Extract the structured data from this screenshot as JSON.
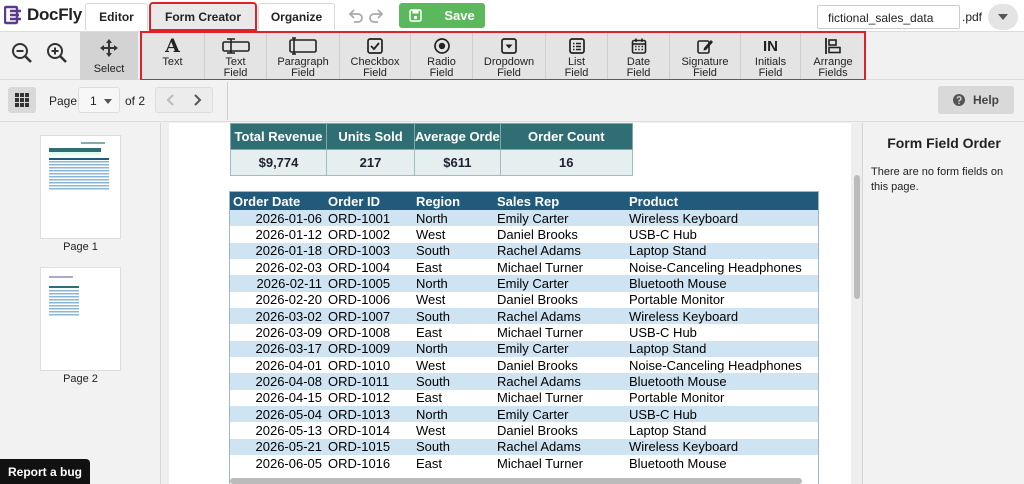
{
  "app": {
    "name": "DocFly"
  },
  "tabs": [
    {
      "label": "Editor"
    },
    {
      "label": "Form Creator"
    },
    {
      "label": "Organize"
    }
  ],
  "save": {
    "label": "Save"
  },
  "file": {
    "name": "fictional_sales_data",
    "ext": ".pdf"
  },
  "select_tool": {
    "label": "Select"
  },
  "form_tools": [
    {
      "l1": "Text",
      "l2": "",
      "icon": "text-icon"
    },
    {
      "l1": "Text",
      "l2": "Field",
      "icon": "text-field-icon"
    },
    {
      "l1": "Paragraph",
      "l2": "Field",
      "icon": "paragraph-field-icon"
    },
    {
      "l1": "Checkbox",
      "l2": "Field",
      "icon": "checkbox-icon"
    },
    {
      "l1": "Radio",
      "l2": "Field",
      "icon": "radio-icon"
    },
    {
      "l1": "Dropdown",
      "l2": "Field",
      "icon": "dropdown-icon"
    },
    {
      "l1": "List",
      "l2": "Field",
      "icon": "list-icon"
    },
    {
      "l1": "Date",
      "l2": "Field",
      "icon": "calendar-icon"
    },
    {
      "l1": "Signature",
      "l2": "Field",
      "icon": "signature-icon"
    },
    {
      "l1": "Initials",
      "l2": "Field",
      "icon": "initials-icon",
      "glyph": "IN"
    },
    {
      "l1": "Arrange",
      "l2": "Fields",
      "icon": "arrange-icon"
    }
  ],
  "pager": {
    "label": "Page",
    "current": "1",
    "total_label": "of 2"
  },
  "help": {
    "label": "Help"
  },
  "thumbnails": [
    {
      "label": "Page 1"
    },
    {
      "label": "Page 2"
    }
  ],
  "report_bug": {
    "label": "Report a bug"
  },
  "summary": {
    "headers": [
      "Total Revenue",
      "Units Sold",
      "Average Orde",
      "Order Count"
    ],
    "values": [
      "$9,774",
      "217",
      "$611",
      "16"
    ]
  },
  "orders": {
    "headers": [
      "Order Date",
      "Order ID",
      "Region",
      "Sales Rep",
      "Product"
    ],
    "rows": [
      [
        "2026-01-06",
        "ORD-1001",
        "North",
        "Emily Carter",
        "Wireless Keyboard"
      ],
      [
        "2026-01-12",
        "ORD-1002",
        "West",
        "Daniel Brooks",
        "USB-C Hub"
      ],
      [
        "2026-01-18",
        "ORD-1003",
        "South",
        "Rachel Adams",
        "Laptop Stand"
      ],
      [
        "2026-02-03",
        "ORD-1004",
        "East",
        "Michael Turner",
        "Noise-Canceling Headphones"
      ],
      [
        "2026-02-11",
        "ORD-1005",
        "North",
        "Emily Carter",
        "Bluetooth Mouse"
      ],
      [
        "2026-02-20",
        "ORD-1006",
        "West",
        "Daniel Brooks",
        "Portable Monitor"
      ],
      [
        "2026-03-02",
        "ORD-1007",
        "South",
        "Rachel Adams",
        "Wireless Keyboard"
      ],
      [
        "2026-03-09",
        "ORD-1008",
        "East",
        "Michael Turner",
        "USB-C Hub"
      ],
      [
        "2026-03-17",
        "ORD-1009",
        "North",
        "Emily Carter",
        "Laptop Stand"
      ],
      [
        "2026-04-01",
        "ORD-1010",
        "West",
        "Daniel Brooks",
        "Noise-Canceling Headphones"
      ],
      [
        "2026-04-08",
        "ORD-1011",
        "South",
        "Rachel Adams",
        "Bluetooth Mouse"
      ],
      [
        "2026-04-15",
        "ORD-1012",
        "East",
        "Michael Turner",
        "Portable Monitor"
      ],
      [
        "2026-05-04",
        "ORD-1013",
        "North",
        "Emily Carter",
        "USB-C Hub"
      ],
      [
        "2026-05-13",
        "ORD-1014",
        "West",
        "Daniel Brooks",
        "Laptop Stand"
      ],
      [
        "2026-05-21",
        "ORD-1015",
        "South",
        "Rachel Adams",
        "Wireless Keyboard"
      ],
      [
        "2026-06-05",
        "ORD-1016",
        "East",
        "Michael Turner",
        "Bluetooth Mouse"
      ]
    ]
  },
  "right_panel": {
    "title": "Form Field Order",
    "message": "There are no form fields on this page."
  },
  "colors": {
    "accent": "#5b3a8e",
    "save": "#5cb85c",
    "highlight": "#e0202a",
    "table_header": "#215a7a",
    "summary_header": "#2f6f74"
  }
}
